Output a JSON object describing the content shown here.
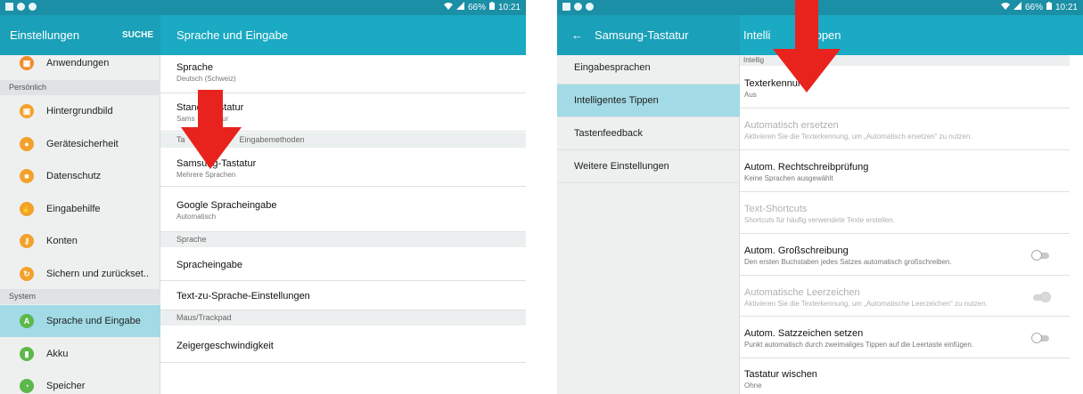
{
  "left": {
    "statusbar": {
      "signal": "☰",
      "battery": "66%",
      "time": "10:21"
    },
    "toolbar": {
      "title": "Einstellungen",
      "search_label": "SUCHE",
      "page_title": "Sprache und Eingabe"
    },
    "sidebar": {
      "top_item": {
        "label": "Anwendungen",
        "icon": "apps-icon",
        "color": "#f08c2e"
      },
      "header_personal": "Persönlich",
      "personal": [
        {
          "label": "Hintergrundbild",
          "icon": "wallpaper-icon",
          "color": "#f3a12b"
        },
        {
          "label": "Gerätesicherheit",
          "icon": "lock-icon",
          "color": "#f3a12b"
        },
        {
          "label": "Datenschutz",
          "icon": "privacy-icon",
          "color": "#f3a12b"
        },
        {
          "label": "Eingabehilfe",
          "icon": "hand-icon",
          "color": "#f3a12b"
        },
        {
          "label": "Konten",
          "icon": "key-icon",
          "color": "#f3a12b"
        },
        {
          "label": "Sichern und zurückset..",
          "icon": "backup-icon",
          "color": "#f3a12b"
        }
      ],
      "header_system": "System",
      "system": [
        {
          "label": "Sprache und Eingabe",
          "icon": "language-icon",
          "color": "#5cb84a"
        },
        {
          "label": "Akku",
          "icon": "battery-icon",
          "color": "#5cb84a"
        },
        {
          "label": "Speicher",
          "icon": "storage-icon",
          "color": "#5cb84a"
        }
      ]
    },
    "content": {
      "row1": {
        "title": "Sprache",
        "sub": "Deutsch (Schweiz)"
      },
      "row2": {
        "title_a": "Stand",
        "title_b": "statur",
        "sub_a": "Sams",
        "sub_b": "atur"
      },
      "header1": {
        "a": "Ta",
        "b": "Eingabemethoden"
      },
      "row3": {
        "title": "Samsung-Tastatur",
        "sub": "Mehrere Sprachen"
      },
      "row4": {
        "title": "Google Spracheingabe",
        "sub": "Automatisch"
      },
      "header2": "Sprache",
      "row5": {
        "title": "Spracheingabe"
      },
      "row6": {
        "title": "Text-zu-Sprache-Einstellungen"
      },
      "header3": "Maus/Trackpad",
      "row7": {
        "title": "Zeigergeschwindigkeit"
      }
    }
  },
  "right": {
    "statusbar": {
      "battery": "66%",
      "time": "10:21"
    },
    "toolbar": {
      "back": "←",
      "title": "Samsung-Tastatur",
      "page_title_a": "Intelli",
      "page_title_b": "s Tippen"
    },
    "subnav": [
      "Eingabesprachen",
      "Intelligentes Tippen",
      "Tastenfeedback",
      "Weitere Einstellungen"
    ],
    "content": {
      "header": {
        "a": "Intellig",
        "b": "ppen"
      },
      "row1": {
        "title": "Texterkennung",
        "sub": "Aus"
      },
      "row2": {
        "title": "Automatisch ersetzen",
        "sub": "Aktivieren Sie die Texterkennung, um „Automatisch ersetzen“ zu nutzen."
      },
      "row3": {
        "title": "Autom. Rechtschreibprüfung",
        "sub": "Keine Sprachen ausgewählt"
      },
      "row4": {
        "title": "Text-Shortcuts",
        "sub": "Shortcuts für häufig verwendete Texte erstellen."
      },
      "row5": {
        "title": "Autom. Großschreibung",
        "sub": "Den ersten Buchstaben jedes Satzes automatisch großschreiben.",
        "toggle": "off"
      },
      "row6": {
        "title": "Automatische Leerzeichen",
        "sub": "Aktivieren Sie die Texterkennung, um „Automatische Leerzeichen“ zu nutzen.",
        "toggle": "disabled"
      },
      "row7": {
        "title": "Autom. Satzzeichen setzen",
        "sub": "Punkt automatisch durch zweimaliges Tippen auf die Leertaste einfügen.",
        "toggle": "off"
      },
      "row8": {
        "title": "Tastatur wischen",
        "sub": "Ohne"
      }
    }
  },
  "colors": {
    "statusbar": "#1a8fa6",
    "toolbar": "#1aaac3",
    "selected": "#a2dbe5",
    "arrow": "#e8231d"
  }
}
